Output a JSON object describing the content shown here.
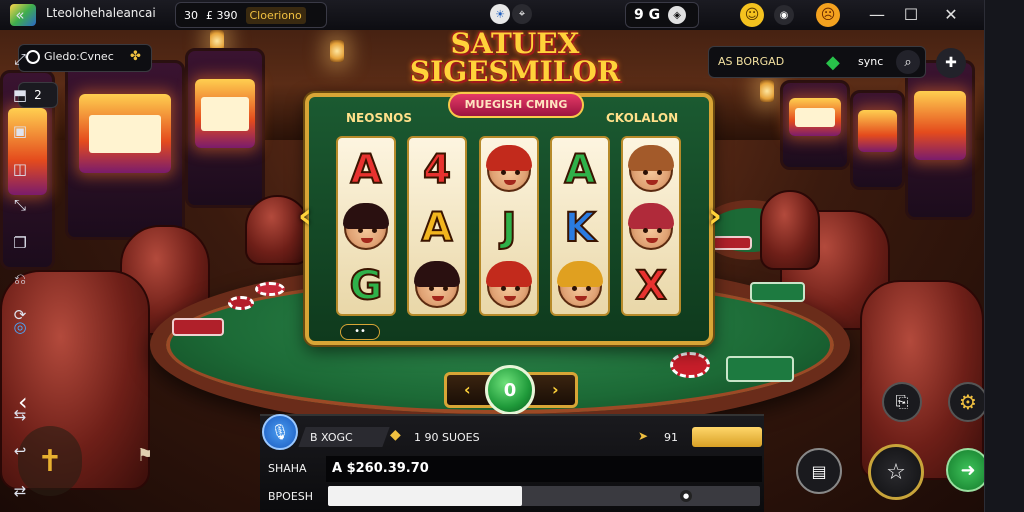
{
  "window": {
    "app_title": "Lteolohehaleancai",
    "top_pill": {
      "left_text": "30",
      "mid_text": "£ 390",
      "right_text": "Cloeriono"
    },
    "top_icons": [
      "sun-icon",
      "location-icon",
      "compass-icon"
    ],
    "counter_pill": {
      "text": "9 G"
    },
    "emoji_icons": [
      "smile-icon",
      "frown-icon"
    ],
    "controls": {
      "minimize": "—",
      "maximize": "☐",
      "close": "✕",
      "collapse": "«"
    }
  },
  "game": {
    "title_line1": "SATUEX",
    "title_line2": "SIGESMILOR",
    "subtitle": "MUEGISH CMING",
    "reel_header_left": "NEOSNOS",
    "reel_header_right": "CKOLALON",
    "reels": [
      [
        {
          "kind": "letter",
          "text": "A",
          "color": "#e8322f"
        },
        {
          "kind": "face",
          "hair": "#2a1010"
        },
        {
          "kind": "letter",
          "text": "G",
          "color": "#2fb14a"
        }
      ],
      [
        {
          "kind": "letter",
          "text": "4",
          "color": "#e8322f"
        },
        {
          "kind": "letter",
          "text": "A",
          "color": "#f2b51e"
        },
        {
          "kind": "face",
          "hair": "#2a1010"
        }
      ],
      [
        {
          "kind": "face",
          "hair": "#c22a1c"
        },
        {
          "kind": "letter",
          "text": "J",
          "color": "#2fb14a"
        },
        {
          "kind": "face",
          "hair": "#c22a1c"
        }
      ],
      [
        {
          "kind": "letter",
          "text": "A",
          "color": "#2fb14a"
        },
        {
          "kind": "letter",
          "text": "K",
          "color": "#2a7be0"
        },
        {
          "kind": "face",
          "hair": "#e0a020"
        }
      ],
      [
        {
          "kind": "face",
          "hair": "#a35a2a"
        },
        {
          "kind": "face",
          "hair": "#b02a3a"
        },
        {
          "kind": "letter",
          "text": "X",
          "color": "#e8322f"
        }
      ]
    ],
    "spin_value": "0",
    "bottom_left_badge": "••"
  },
  "left_panel": {
    "header": "Gledo:Cvnec",
    "sub_badge": "2"
  },
  "right_panel": {
    "badge_text": "AS BORGAD",
    "icon_text": "sync"
  },
  "bottom_panel": {
    "mic_label": "B XOGC",
    "coins_label": "1 90 SUOES",
    "right_count": "91",
    "balance_label": "SHAHA",
    "balance_value": "A $260.39.70",
    "progress_label": "BPOESH",
    "progress_fraction": 0.45
  },
  "colors": {
    "accent_gold": "#ffd23a",
    "felt_green": "#1c6a36",
    "sidebar_bg": "#15161c"
  }
}
